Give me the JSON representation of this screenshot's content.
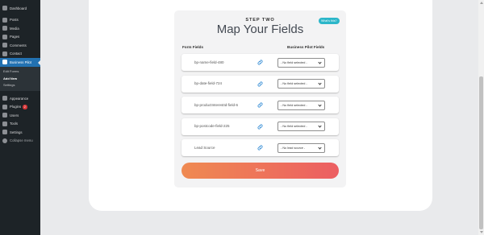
{
  "sidebar": {
    "items": [
      {
        "label": "Dashboard",
        "icon": "dashboard-icon"
      },
      {
        "label": "Posts",
        "icon": "posts-icon"
      },
      {
        "label": "Media",
        "icon": "media-icon"
      },
      {
        "label": "Pages",
        "icon": "pages-icon"
      },
      {
        "label": "Comments",
        "icon": "comments-icon"
      },
      {
        "label": "Contact",
        "icon": "contact-icon"
      },
      {
        "label": "Business Pilot",
        "icon": "business-pilot-icon",
        "active": true
      }
    ],
    "submenu": [
      {
        "label": "Edit Forms"
      },
      {
        "label": "Add New",
        "current": true
      },
      {
        "label": "Settings"
      }
    ],
    "items2": [
      {
        "label": "Appearance",
        "icon": "appearance-icon"
      },
      {
        "label": "Plugins",
        "icon": "plugins-icon",
        "badge": "2"
      },
      {
        "label": "Users",
        "icon": "users-icon"
      },
      {
        "label": "Tools",
        "icon": "tools-icon"
      },
      {
        "label": "Settings",
        "icon": "settings-icon"
      },
      {
        "label": "Collapse menu",
        "icon": "collapse-icon"
      }
    ]
  },
  "card": {
    "step": "STEP TWO",
    "title": "Map Your Fields",
    "help_label": "What's this?",
    "col_form": "Form Fields",
    "col_bp": "Business Pilot Fields",
    "rows": [
      {
        "field": "bp-name-field-480",
        "select": "- No field selected -"
      },
      {
        "field": "bp-date-field-724",
        "select": "- No field selected -"
      },
      {
        "field": "bp-productInterestId-field-6",
        "select": "- No field selected -"
      },
      {
        "field": "bp-postcode-field-225",
        "select": "- No field selected -"
      },
      {
        "field": "Lead Source",
        "select": "- No lead source -"
      }
    ],
    "save_label": "Save"
  },
  "colors": {
    "sidebar_bg": "#1d2327",
    "active_menu": "#2271b1",
    "help_button": "#2cb6c9",
    "save_gradient_start": "#ef8a52",
    "save_gradient_end": "#ec5e62",
    "link_icon": "#2b87d3"
  }
}
